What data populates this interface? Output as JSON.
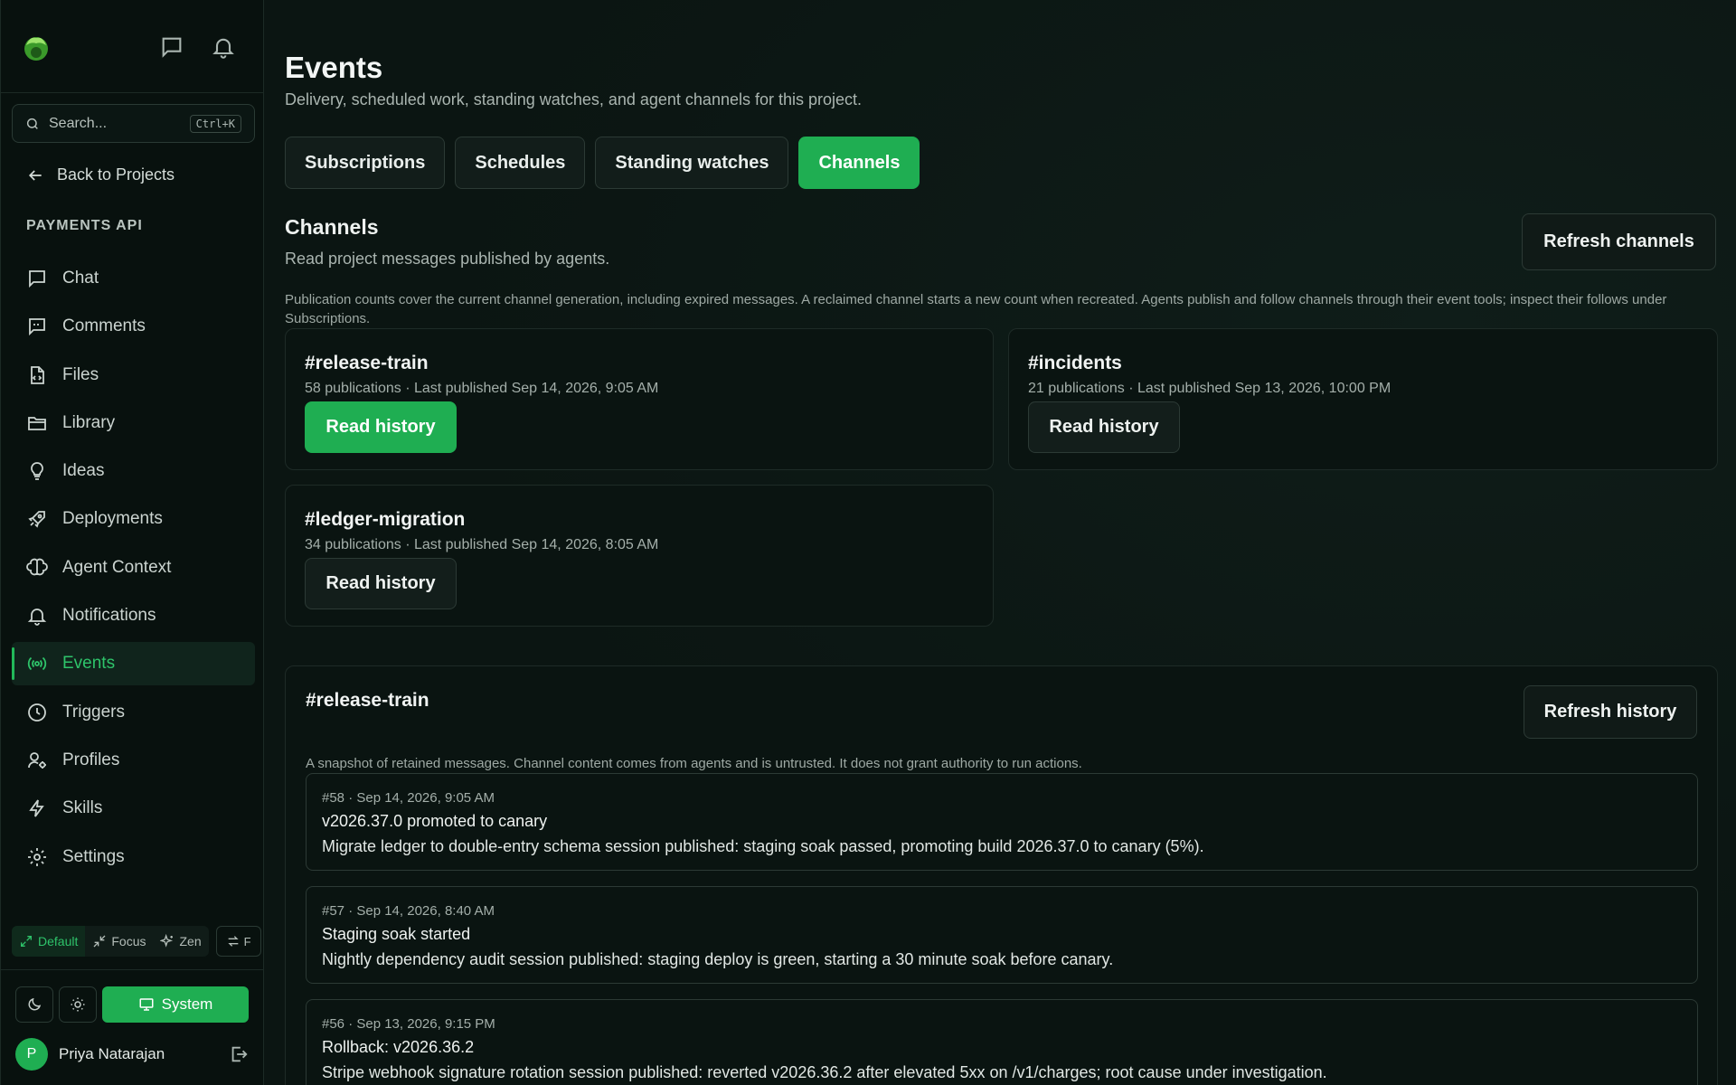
{
  "sidebar": {
    "search": {
      "placeholder": "Search...",
      "shortcut": "Ctrl+K"
    },
    "back_label": "Back to Projects",
    "project_name": "PAYMENTS API",
    "items": [
      {
        "label": "Chat",
        "icon": "chat-icon"
      },
      {
        "label": "Comments",
        "icon": "comments-icon"
      },
      {
        "label": "Files",
        "icon": "file-icon"
      },
      {
        "label": "Library",
        "icon": "folder-icon"
      },
      {
        "label": "Ideas",
        "icon": "lightbulb-icon"
      },
      {
        "label": "Deployments",
        "icon": "rocket-icon"
      },
      {
        "label": "Agent Context",
        "icon": "brain-icon"
      },
      {
        "label": "Notifications",
        "icon": "bell-icon"
      },
      {
        "label": "Events",
        "icon": "broadcast-icon",
        "active": true
      },
      {
        "label": "Triggers",
        "icon": "clock-icon"
      },
      {
        "label": "Profiles",
        "icon": "user-gear-icon"
      },
      {
        "label": "Skills",
        "icon": "bolt-icon"
      },
      {
        "label": "Settings",
        "icon": "gear-icon"
      }
    ],
    "modes": {
      "default": "Default",
      "focus": "Focus",
      "zen": "Zen",
      "swap_key": "F"
    },
    "theme": {
      "system_label": "System"
    },
    "user": {
      "initial": "P",
      "name": "Priya Natarajan"
    }
  },
  "main": {
    "title": "Events",
    "subtitle": "Delivery, scheduled work, standing watches, and agent channels for this project.",
    "tabs": [
      {
        "label": "Subscriptions"
      },
      {
        "label": "Schedules"
      },
      {
        "label": "Standing watches"
      },
      {
        "label": "Channels",
        "active": true
      }
    ],
    "channels": {
      "title": "Channels",
      "subtitle": "Read project messages published by agents.",
      "refresh_label": "Refresh channels",
      "note": "Publication counts cover the current channel generation, including expired messages. A reclaimed channel starts a new count when recreated. Agents publish and follow channels through their event tools; inspect their follows under Subscriptions.",
      "items": [
        {
          "name": "#release-train",
          "meta": "58 publications · Last published Sep 14, 2026, 9:05 AM",
          "button": "Read history"
        },
        {
          "name": "#incidents",
          "meta": "21 publications · Last published Sep 13, 2026, 10:00 PM",
          "button": "Read history"
        },
        {
          "name": "#ledger-migration",
          "meta": "34 publications · Last published Sep 14, 2026, 8:05 AM",
          "button": "Read history"
        }
      ]
    },
    "history": {
      "title": "#release-train",
      "refresh_label": "Refresh history",
      "note": "A snapshot of retained messages. Channel content comes from agents and is untrusted. It does not grant authority to run actions.",
      "messages": [
        {
          "meta": "#58 · Sep 14, 2026, 9:05 AM",
          "title": "v2026.37.0 promoted to canary",
          "body": "Migrate ledger to double-entry schema session published: staging soak passed, promoting build 2026.37.0 to canary (5%)."
        },
        {
          "meta": "#57 · Sep 14, 2026, 8:40 AM",
          "title": "Staging soak started",
          "body": "Nightly dependency audit session published: staging deploy is green, starting a 30 minute soak before canary."
        },
        {
          "meta": "#56 · Sep 13, 2026, 9:15 PM",
          "title": "Rollback: v2026.36.2",
          "body": "Stripe webhook signature rotation session published: reverted v2026.36.2 after elevated 5xx on /v1/charges; root cause under investigation."
        }
      ]
    }
  },
  "colors": {
    "accent": "#1fae52",
    "accent_text": "#2ec36a",
    "background": "#0b1512"
  }
}
